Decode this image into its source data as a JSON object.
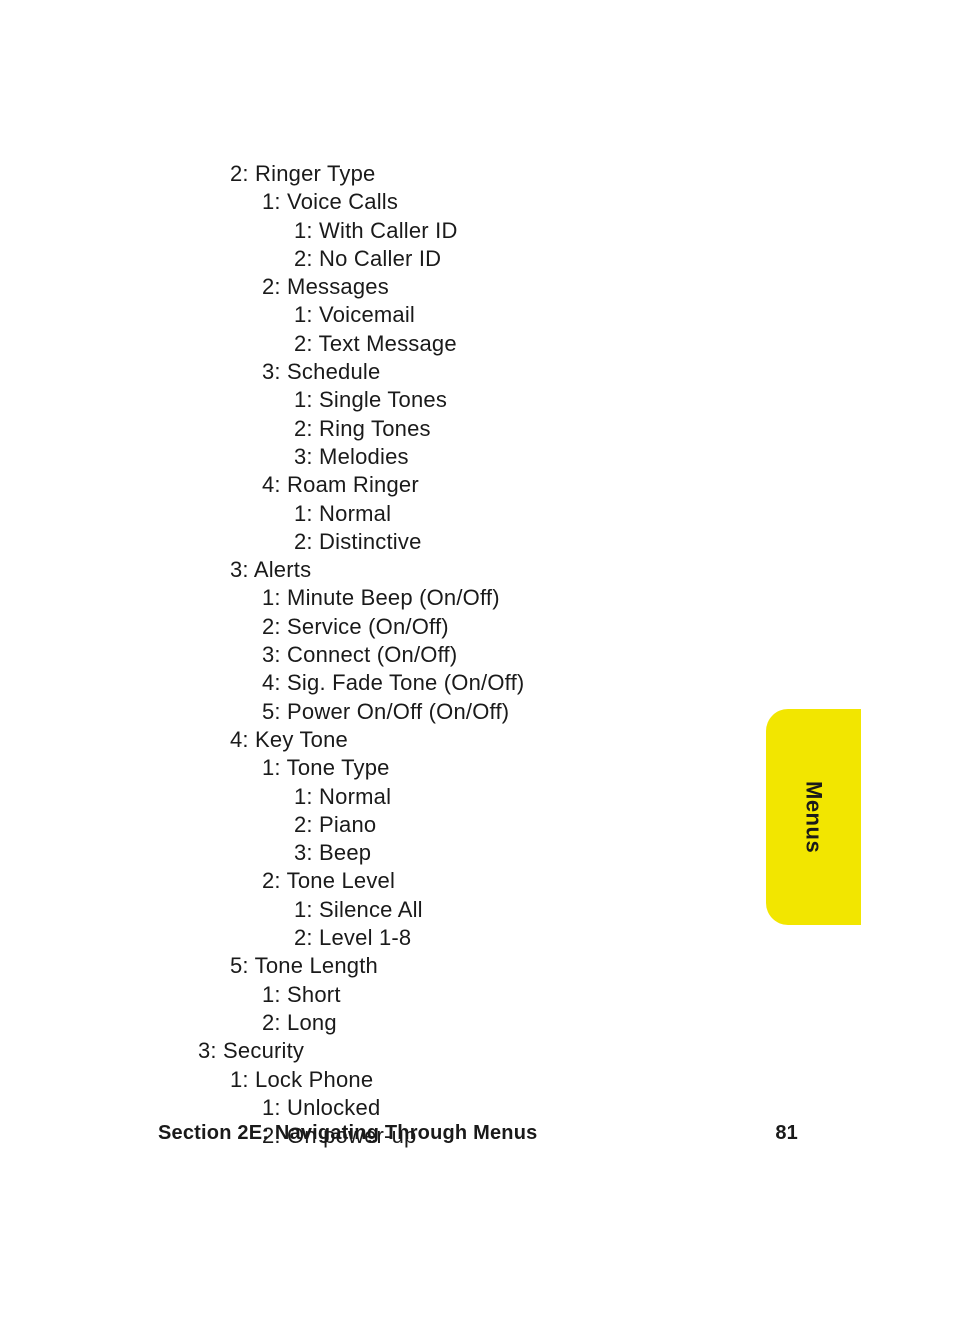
{
  "lines": [
    {
      "indent": 1,
      "text": "2: Ringer Type"
    },
    {
      "indent": 2,
      "text": "1: Voice Calls"
    },
    {
      "indent": 3,
      "text": "1: With Caller ID"
    },
    {
      "indent": 3,
      "text": "2: No Caller ID"
    },
    {
      "indent": 2,
      "text": "2: Messages"
    },
    {
      "indent": 3,
      "text": "1: Voicemail"
    },
    {
      "indent": 3,
      "text": "2: Text Message"
    },
    {
      "indent": 2,
      "text": "3: Schedule"
    },
    {
      "indent": 3,
      "text": "1: Single Tones"
    },
    {
      "indent": 3,
      "text": "2: Ring Tones"
    },
    {
      "indent": 3,
      "text": "3: Melodies"
    },
    {
      "indent": 2,
      "text": "4: Roam Ringer"
    },
    {
      "indent": 3,
      "text": "1: Normal"
    },
    {
      "indent": 3,
      "text": "2: Distinctive"
    },
    {
      "indent": 1,
      "text": "3: Alerts"
    },
    {
      "indent": 2,
      "text": "1: Minute Beep (On/Off)"
    },
    {
      "indent": 2,
      "text": "2: Service (On/Off)"
    },
    {
      "indent": 2,
      "text": "3: Connect (On/Off)"
    },
    {
      "indent": 2,
      "text": "4: Sig. Fade Tone (On/Off)"
    },
    {
      "indent": 2,
      "text": "5: Power On/Off (On/Off)"
    },
    {
      "indent": 1,
      "text": "4: Key Tone"
    },
    {
      "indent": 2,
      "text": "1: Tone Type"
    },
    {
      "indent": 3,
      "text": "1: Normal"
    },
    {
      "indent": 3,
      "text": "2: Piano"
    },
    {
      "indent": 3,
      "text": "3: Beep"
    },
    {
      "indent": 2,
      "text": "2: Tone Level"
    },
    {
      "indent": 3,
      "text": "1: Silence All"
    },
    {
      "indent": 3,
      "text": "2: Level 1-8"
    },
    {
      "indent": 1,
      "text": "5: Tone Length"
    },
    {
      "indent": 2,
      "text": "1: Short"
    },
    {
      "indent": 2,
      "text": "2: Long"
    },
    {
      "indent": 0,
      "text": "3: Security"
    },
    {
      "indent": 1,
      "text": "1: Lock Phone"
    },
    {
      "indent": 2,
      "text": "1: Unlocked"
    },
    {
      "indent": 2,
      "text": "2: On power-up"
    }
  ],
  "footer": {
    "section": "Section 2E: Navigating Through Menus",
    "page": "81"
  },
  "tab_label": "Menus"
}
